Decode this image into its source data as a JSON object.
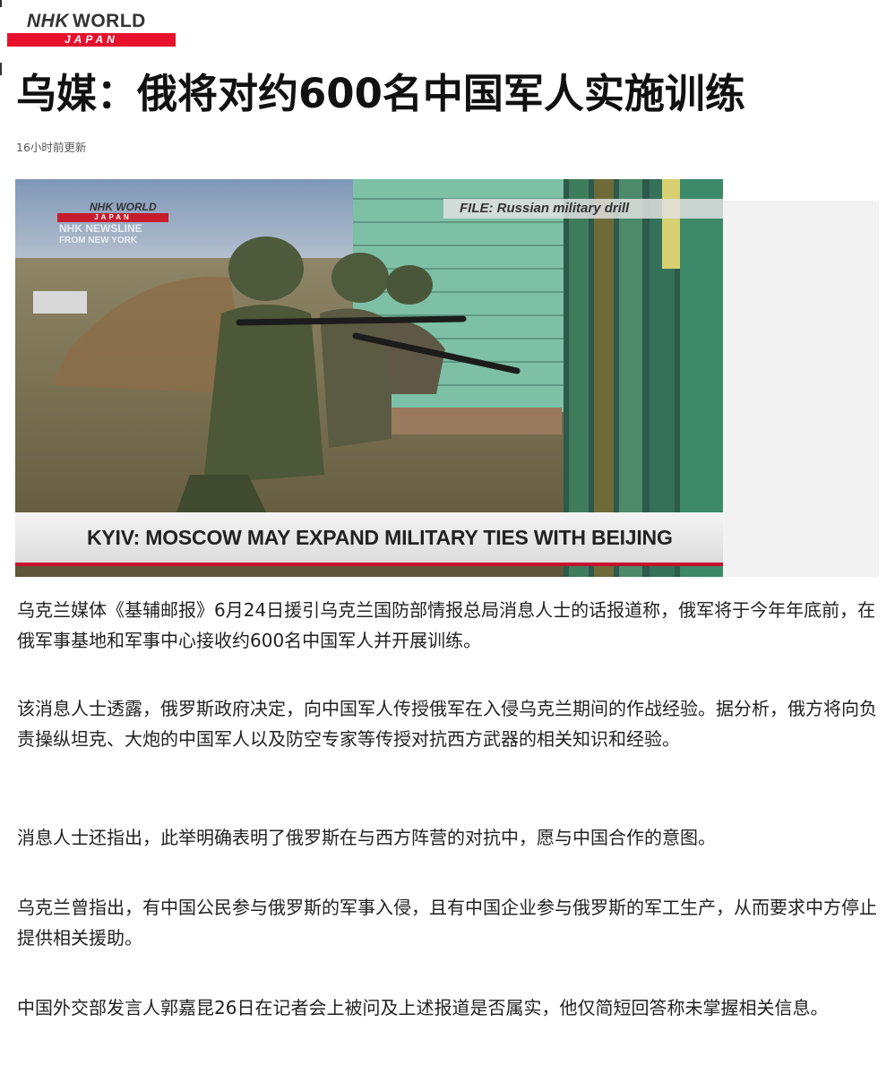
{
  "brand": {
    "top_text_nhk": "NHK",
    "top_text_world": "WORLD",
    "bar_text": "JAPAN"
  },
  "article": {
    "headline": "乌媒：俄将对约600名中国军人实施训练",
    "updated": "16小时前更新",
    "paragraphs": [
      "乌克兰媒体《基辅邮报》6月24日援引乌克兰国防部情报总局消息人士的话报道称，俄军将于今年年底前，在俄军事基地和军事中心接收约600名中国军人并开展训练。",
      "该消息人士透露，俄罗斯政府决定，向中国军人传授俄军在入侵乌克兰期间的作战经验。据分析，俄方将向负责操纵坦克、大炮的中国军人以及防空专家等传授对抗西方武器的相关知识和经验。",
      "消息人士还指出，此举明确表明了俄罗斯在与西方阵营的对抗中，愿与中国合作的意图。",
      "乌克兰曾指出，有中国公民参与俄罗斯的军事入侵，且有中国企业参与俄罗斯的军工生产，从而要求中方停止提供相关援助。",
      "中国外交部发言人郭嘉昆26日在记者会上被问及上述报道是否属实，他仅简短回答称未掌握相关信息。"
    ]
  },
  "image": {
    "watermark_top": "NHK WORLD",
    "watermark_bar": "JAPAN",
    "watermark_line1": "NHK NEWSLINE",
    "watermark_line2": "FROM NEW YORK",
    "file_label": "FILE: Russian military drill",
    "lower_third": "KYIV: MOSCOW MAY EXPAND MILITARY TIES WITH BEIJING"
  },
  "colors": {
    "brand_red": "#e8112d",
    "lower_third_rule": "#c8102e"
  }
}
